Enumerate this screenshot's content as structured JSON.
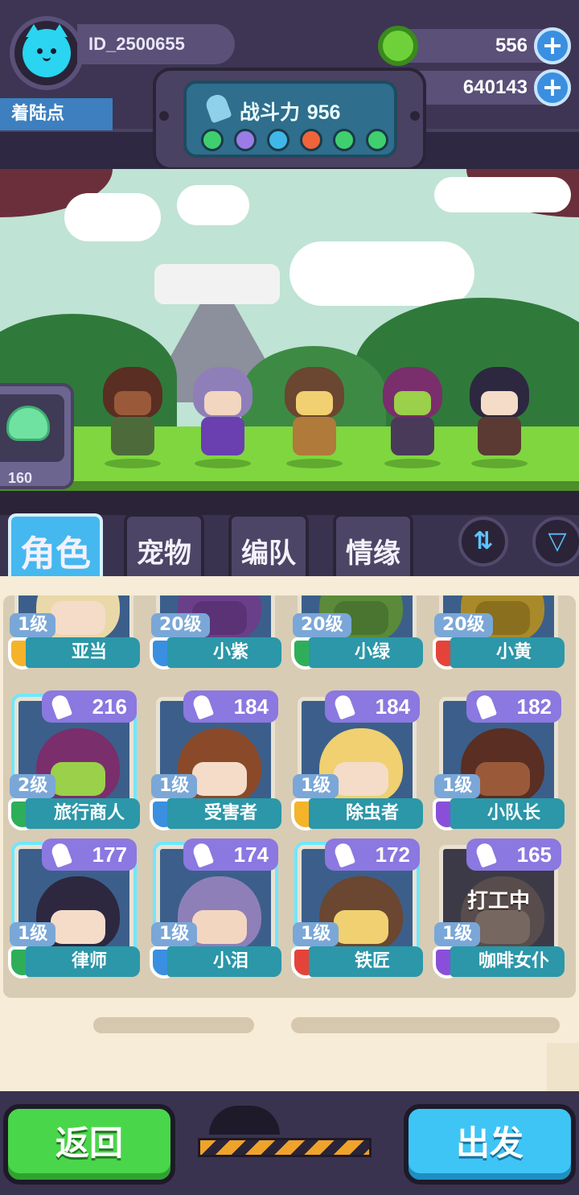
{
  "profile": {
    "player_id": "ID_2500655",
    "location_tab": "着陆点"
  },
  "resources": {
    "gems": "556",
    "gold": "640143"
  },
  "power": {
    "label": "战斗力",
    "value": "956",
    "elements": [
      "leaf",
      "moon",
      "water",
      "fire",
      "leaf",
      "leaf"
    ]
  },
  "pet_card": {
    "value": "160"
  },
  "tabs": [
    {
      "label": "角色",
      "active": true
    },
    {
      "label": "宠物",
      "active": false
    },
    {
      "label": "编队",
      "active": false
    },
    {
      "label": "情缘",
      "active": false
    }
  ],
  "roster": {
    "top_row": [
      {
        "level": "1级",
        "name": "亚当",
        "element_color": "#f5b32a"
      },
      {
        "level": "20级",
        "name": "小紫",
        "element_color": "#3a8fe0"
      },
      {
        "level": "20级",
        "name": "小绿",
        "element_color": "#2fae5a"
      },
      {
        "level": "20级",
        "name": "小黄",
        "element_color": "#e5433a"
      }
    ],
    "cards": [
      {
        "power": "216",
        "level": "2级",
        "name": "旅行商人",
        "element_color": "#2fae5a",
        "busy": ""
      },
      {
        "power": "184",
        "level": "1级",
        "name": "受害者",
        "element_color": "#3a8fe0",
        "busy": ""
      },
      {
        "power": "184",
        "level": "1级",
        "name": "除虫者",
        "element_color": "#f5b32a",
        "busy": ""
      },
      {
        "power": "182",
        "level": "1级",
        "name": "小队长",
        "element_color": "#8a4fd8",
        "busy": ""
      },
      {
        "power": "177",
        "level": "1级",
        "name": "律师",
        "element_color": "#2fae5a",
        "busy": ""
      },
      {
        "power": "174",
        "level": "1级",
        "name": "小泪",
        "element_color": "#3a8fe0",
        "busy": ""
      },
      {
        "power": "172",
        "level": "1级",
        "name": "铁匠",
        "element_color": "#e5433a",
        "busy": ""
      },
      {
        "power": "165",
        "level": "1级",
        "name": "咖啡女仆",
        "element_color": "#8a4fd8",
        "busy": "打工中"
      }
    ]
  },
  "buttons": {
    "back": "返回",
    "depart": "出发"
  }
}
